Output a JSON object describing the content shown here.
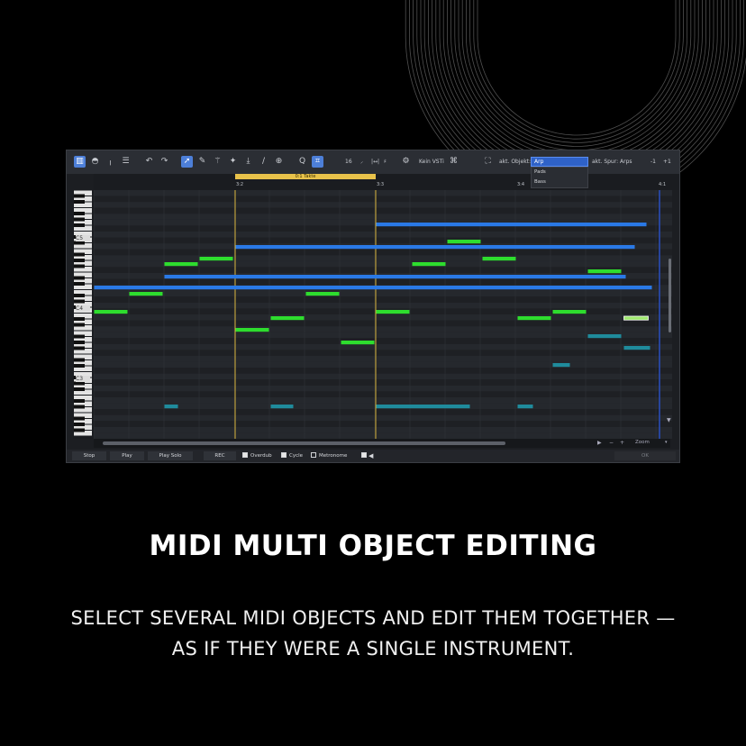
{
  "toolbar": {
    "quantize_value": "16",
    "vsti_label": "Kein VSTi",
    "object_label": "akt. Objekt:",
    "object_selected": "Arp",
    "object_options": [
      "Pads",
      "Bass"
    ],
    "track_label": "akt. Spur: Arps",
    "minus_one": "-1",
    "plus_one": "+1"
  },
  "timeline": {
    "range_label": "0:1 Takte",
    "markers": [
      "3:2",
      "3:3",
      "3:4",
      "4:1"
    ]
  },
  "keyboard": {
    "octave_labels": [
      "C5",
      "C4",
      "C3"
    ]
  },
  "transport": {
    "stop": "Stop",
    "play": "Play",
    "play_solo": "Play Solo",
    "rec": "REC",
    "overdub": "Overdub",
    "cycle": "Cycle",
    "metronome": "Metronome",
    "zoom": "Zoom",
    "ok": "OK",
    "overdub_checked": true,
    "cycle_checked": true,
    "metronome_checked": false
  },
  "notes": {
    "colors": {
      "blue": "#2a79e6",
      "green": "#2edd2e",
      "teal": "#1f8b9c",
      "selected": "#9fe96e"
    }
  },
  "marketing": {
    "headline": "MIDI MULTI OBJECT EDITING",
    "subline_1": "SELECT SEVERAL MIDI OBJECTS AND EDIT THEM TOGETHER —",
    "subline_2": "AS IF THEY WERE A SINGLE INSTRUMENT."
  }
}
